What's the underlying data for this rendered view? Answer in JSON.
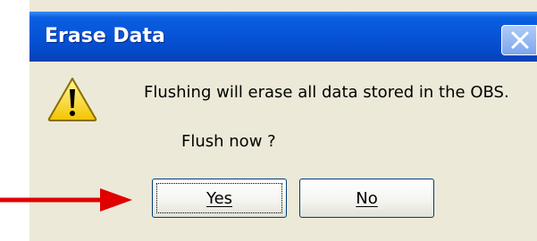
{
  "dialog": {
    "title": "Erase Data",
    "message": "Flushing will erase all data stored in the OBS.",
    "question": "Flush now ?",
    "buttons": {
      "yes_label": "Yes",
      "no_label": "No"
    },
    "icons": {
      "dialog_icon": "warning-icon",
      "close_icon": "close-icon"
    }
  },
  "colors": {
    "titlebar": "#0753d6",
    "client_background": "#ece9d8",
    "arrow": "#e00000"
  }
}
